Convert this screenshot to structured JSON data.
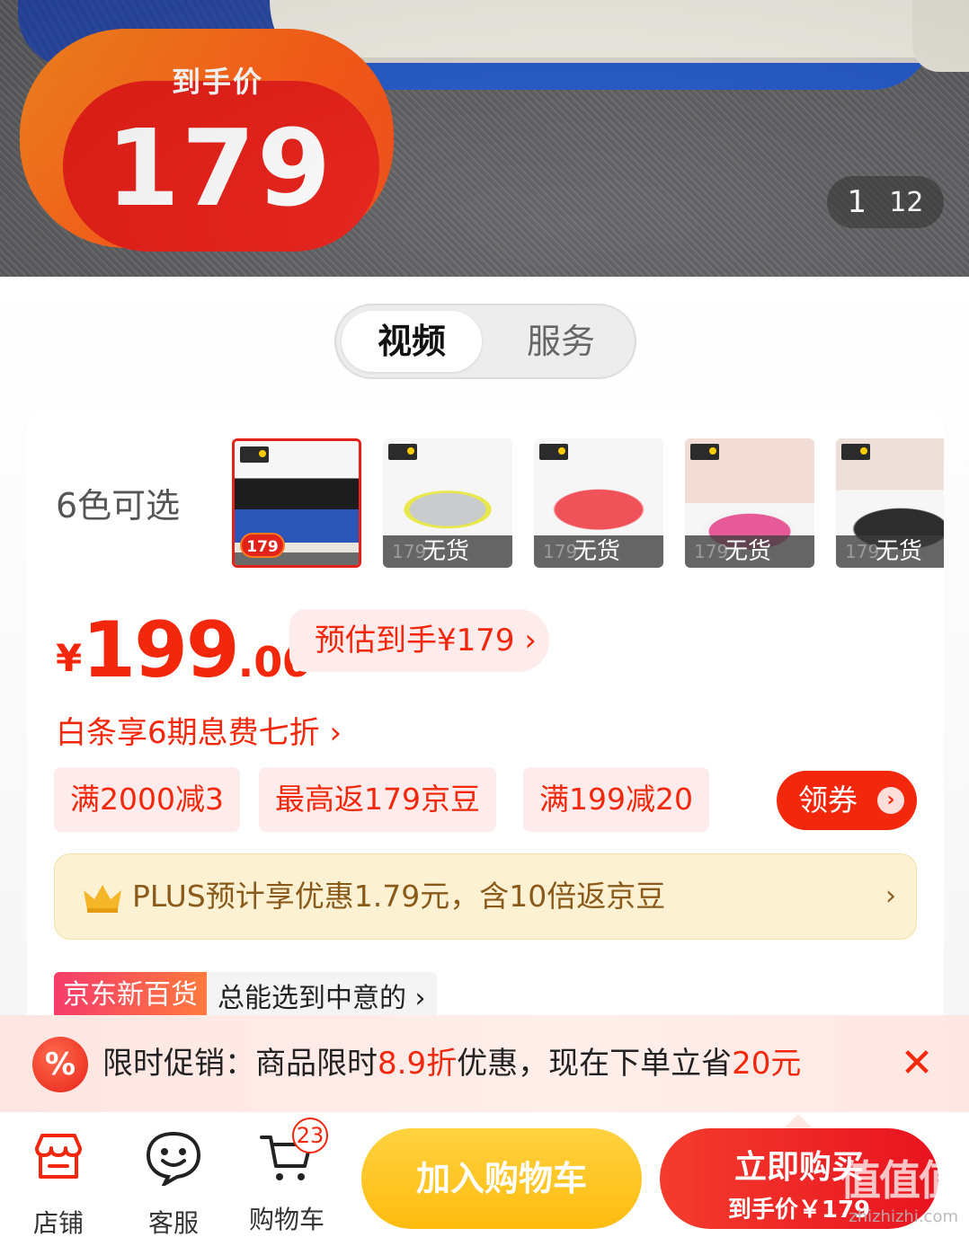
{
  "hero": {
    "badge_label": "到手价",
    "badge_price": "179",
    "pager_current": "1",
    "pager_total": "12"
  },
  "tabs": [
    {
      "label": "视频",
      "active": true
    },
    {
      "label": "服务",
      "active": false
    }
  ],
  "colors": {
    "label": "6色可选",
    "swatches": [
      {
        "name": "blue",
        "selected": true,
        "badge": "179",
        "oos": ""
      },
      {
        "name": "grey-yellow",
        "selected": false,
        "ghost": "179",
        "oos": "无货"
      },
      {
        "name": "red",
        "selected": false,
        "ghost": "179",
        "oos": "无货"
      },
      {
        "name": "pink",
        "selected": false,
        "ghost": "179",
        "oos": "无货"
      },
      {
        "name": "black",
        "selected": false,
        "ghost": "179",
        "oos": "无货"
      }
    ]
  },
  "price": {
    "currency": "¥",
    "integer": "199",
    "decimal": ".00",
    "estimate": "预估到手¥179 ›"
  },
  "baitiao": "白条享6期息费七折 ›",
  "coupons": [
    "满2000减3",
    "最高返179京豆",
    "满199减20"
  ],
  "get_coupon": {
    "label": "领券",
    "arrow": "›"
  },
  "plus": {
    "text": "PLUS预计享优惠1.79元，含10倍返京豆",
    "arrow": "›"
  },
  "jd_new": {
    "tag": "京东新百货",
    "text": "总能选到中意的 ›"
  },
  "promo": {
    "icon": "%",
    "prefix": "限时促销：商品限时",
    "discount": "8.9折",
    "middle": "优惠，现在下单立省",
    "save": "20元",
    "close": "✕"
  },
  "bottom_nav": {
    "store": "店铺",
    "service": "客服",
    "cart": "购物车",
    "cart_count": "23"
  },
  "actions": {
    "add_to_cart": "加入购物车",
    "buy_now": "立即购买",
    "buy_now_sub": "到手价￥179"
  },
  "watermark": {
    "big": "值值值",
    "small": "zhizhizhi.com"
  },
  "accent_colors": {
    "red": "#f2270c",
    "yellow": "#ffc21a",
    "badge_orange": "#ff5a12"
  }
}
